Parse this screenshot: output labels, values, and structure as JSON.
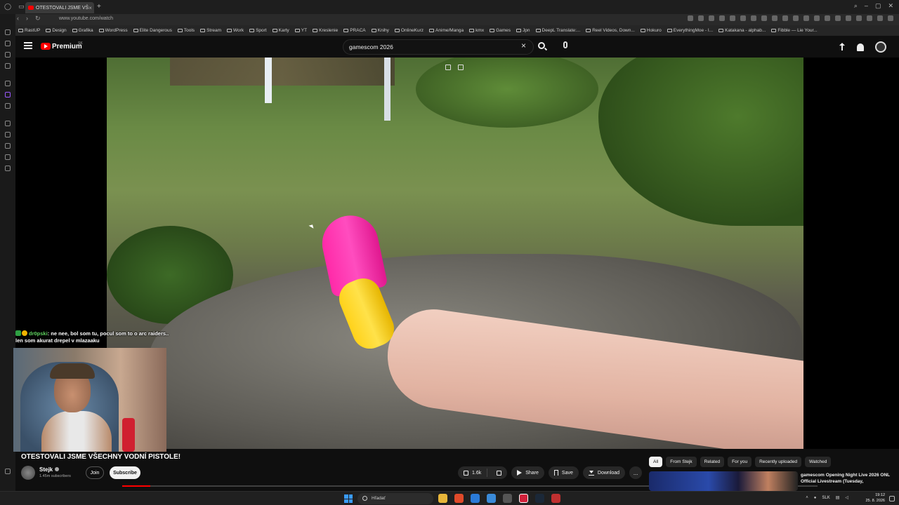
{
  "browser": {
    "tab_title": "OTESTOVALI JSME VŠ",
    "url": "www.youtube.com/watch",
    "bookmarks": [
      "RastUP",
      "Design",
      "Grafika",
      "WordPress",
      "Elite Dangerous",
      "Tools",
      "Stream",
      "Work",
      "Sport",
      "Karty",
      "YT",
      "Kreslenie",
      "PRACA",
      "Knihy",
      "OnlineKurz",
      "Anime/Manga",
      "kmx",
      "Games",
      "Jpn",
      "DeepL Translate:...",
      "Reel Videos, Down...",
      "Hokuro",
      "EverythingMoe - I...",
      "Katakana - alphab...",
      "Fibble — Lie Your..."
    ]
  },
  "youtube": {
    "brand": "Premium",
    "country": "SK",
    "search_query": "gamescom 2026"
  },
  "player": {
    "progress_fraction": 0.04
  },
  "chat": {
    "user": "dr0pski",
    "message": ": ne nee, bol som tu, pocul som to o arc raiders.. len som akurat drepel v mlazaaku"
  },
  "video": {
    "title": "OTESTOVALI JSME VŠECHNY VODNÍ PISTOLE!",
    "channel": "Stejk",
    "subscribers": "1.45m subscribers",
    "join_label": "Join",
    "subscribe_label": "Subscribe",
    "likes": "1.6k",
    "share_label": "Share",
    "save_label": "Save",
    "download_label": "Download",
    "more_label": "..."
  },
  "chips": [
    "All",
    "From Stejk",
    "Related",
    "For you",
    "Recently uploaded",
    "Watched"
  ],
  "recommendation": {
    "title": "gamescom Opening Night Live 2026 ONL Official Livestream (Tuesday,"
  },
  "taskbar": {
    "search_placeholder": "Hľadať",
    "lang": "SLK",
    "time": "19:12",
    "date": "25. 8. 2026"
  },
  "colors": {
    "accent": "#ff0000",
    "background": "#0f0f0f",
    "chip_bg": "#272727"
  }
}
